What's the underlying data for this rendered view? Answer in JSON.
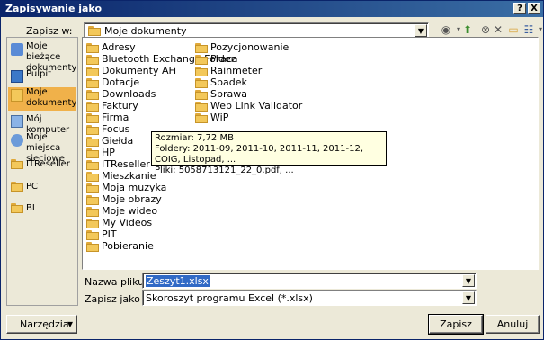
{
  "window": {
    "title": "Zapisywanie jako",
    "help_button": "?",
    "close_button": "X"
  },
  "save_in": {
    "label": "Zapisz w:",
    "value": "Moje dokumenty"
  },
  "places": [
    {
      "label": "Moje bieżące dokumenty",
      "icon": "recent-documents-icon"
    },
    {
      "label": "Pulpit",
      "icon": "desktop-icon"
    },
    {
      "label": "Moje dokumenty",
      "icon": "my-documents-icon",
      "selected": true
    },
    {
      "label": "Mój komputer",
      "icon": "my-computer-icon"
    },
    {
      "label": "Moje miejsca sieciowe",
      "icon": "network-places-icon"
    },
    {
      "label": "ITReseller",
      "icon": "folder-icon"
    },
    {
      "label": "PC",
      "icon": "folder-icon"
    },
    {
      "label": "BI",
      "icon": "folder-icon"
    }
  ],
  "files_col1": [
    "Adresy",
    "Bluetooth Exchange Folder",
    "Dokumenty AFi",
    "Dotacje",
    "Downloads",
    "Faktury",
    "Firma",
    "Focus",
    "Giełda",
    "HP",
    "ITReseller",
    "Mieszkanie",
    "Moja muzyka",
    "Moje obrazy",
    "Moje wideo",
    "My Videos",
    "PIT",
    "Pobieranie"
  ],
  "files_col2": [
    "Pozycjonowanie",
    "Praca",
    "Rainmeter",
    "Spadek",
    "Sprawa",
    "Web Link Validator",
    "WiP"
  ],
  "tooltip": {
    "line1": "Rozmiar: 7,72 MB",
    "line2": "Foldery: 2011-09, 2011-10, 2011-11, 2011-12, COIG, Listopad, ...",
    "line3": "Pliki: 5058713121_22_0.pdf, ..."
  },
  "filename": {
    "label": "Nazwa pliku:",
    "value": "Zeszyt1.xlsx"
  },
  "filetype": {
    "label": "Zapisz jako typ:",
    "value": "Skoroszyt programu Excel (*.xlsx)"
  },
  "buttons": {
    "tools": "Narzędzia",
    "save": "Zapisz",
    "cancel": "Anuluj"
  },
  "colors": {
    "titlebar": "#0a246a",
    "dialog_bg": "#ece9d8",
    "selected_place": "#f0b14a",
    "tooltip_bg": "#ffffe1"
  }
}
